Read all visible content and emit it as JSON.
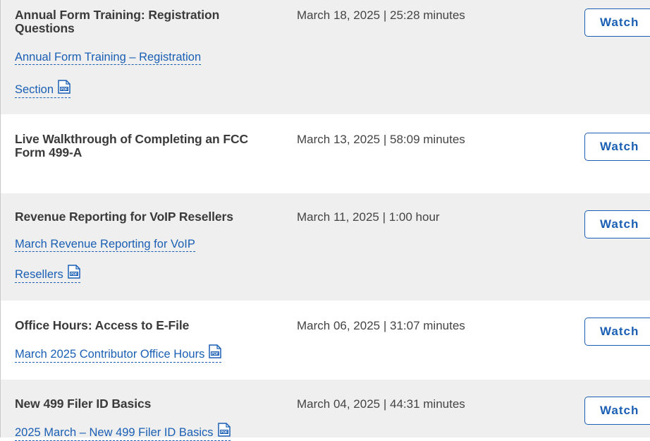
{
  "trainings": [
    {
      "title": "Annual Form Training: Registration Questions",
      "meta": "March 18, 2025 | 25:28 minutes",
      "link_lines": [
        "Annual Form Training – Registration",
        "Section"
      ],
      "watch_label": "Watch"
    },
    {
      "title": "Live Walkthrough of Completing an FCC Form 499-A",
      "meta": "March 13, 2025 | 58:09 minutes",
      "link_lines": [],
      "watch_label": "Watch"
    },
    {
      "title": "Revenue Reporting for VoIP Resellers",
      "meta": "March 11, 2025 | 1:00 hour",
      "link_lines": [
        "March Revenue Reporting for VoIP",
        "Resellers"
      ],
      "watch_label": "Watch"
    },
    {
      "title": "Office Hours: Access to E-File",
      "meta": "March 06, 2025 | 31:07 minutes",
      "link_lines": [
        "March 2025 Contributor Office Hours"
      ],
      "watch_label": "Watch"
    },
    {
      "title": "New 499 Filer ID Basics",
      "meta": "March 04, 2025 | 44:31 minutes",
      "link_lines": [
        "2025 March – New 499 Filer ID Basics"
      ],
      "watch_label": "Watch"
    }
  ],
  "icons": {
    "pdf": "pdf-icon",
    "pdf_badge_text": "PDF"
  },
  "colors": {
    "link": "#1a5fb4",
    "row_shaded": "#efefef",
    "title": "#3a3a3a"
  }
}
